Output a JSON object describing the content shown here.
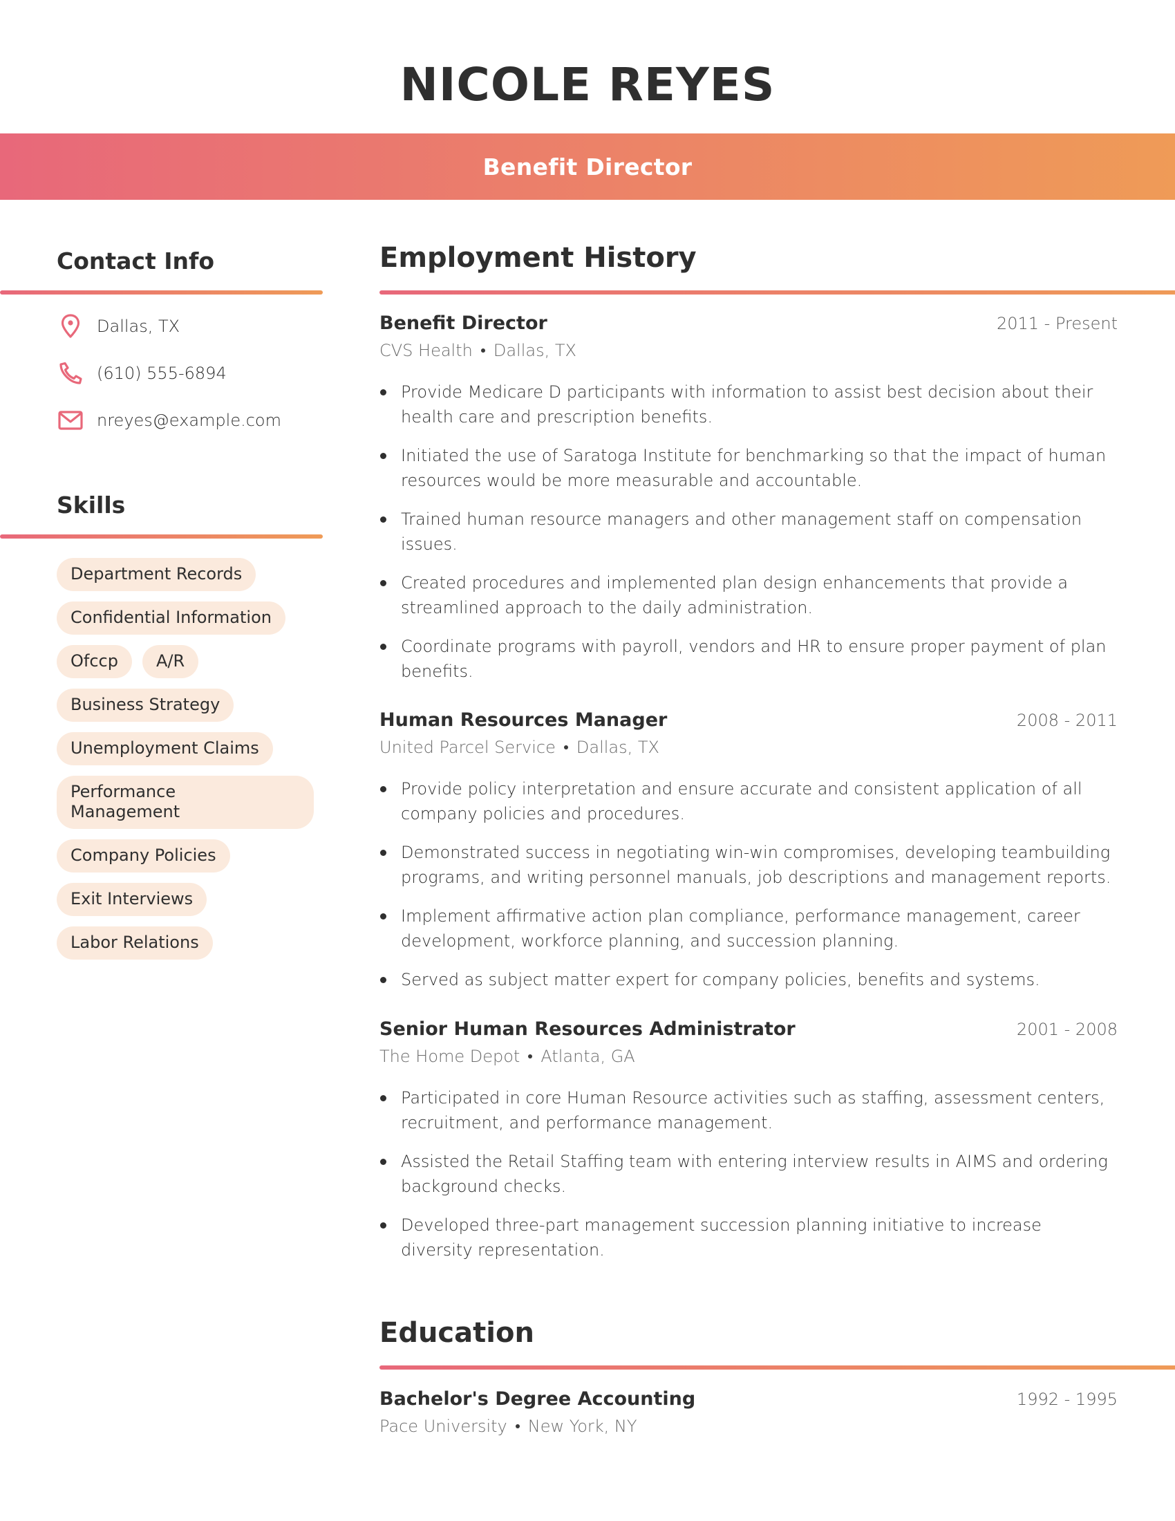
{
  "header": {
    "name": "NICOLE REYES",
    "title": "Benefit Director"
  },
  "colors": {
    "gradient_start": "#E8687A",
    "gradient_end": "#EF9B57",
    "pill_bg": "#FBEADD",
    "text": "#2f2f2f"
  },
  "contact": {
    "heading": "Contact Info",
    "items": [
      {
        "icon": "location-pin-icon",
        "text": "Dallas, TX"
      },
      {
        "icon": "phone-icon",
        "text": "(610) 555-6894"
      },
      {
        "icon": "mail-icon",
        "text": "nreyes@example.com"
      }
    ]
  },
  "skills": {
    "heading": "Skills",
    "items": [
      "Department Records",
      "Confidential Information",
      "Ofccp",
      "A/R",
      "Business Strategy",
      "Unemployment Claims",
      "Performance Management",
      "Company Policies",
      "Exit Interviews",
      "Labor Relations"
    ]
  },
  "employment": {
    "heading": "Employment History",
    "jobs": [
      {
        "title": "Benefit Director",
        "dates": "2011 - Present",
        "company": "CVS Health",
        "location": "Dallas, TX",
        "bullets": [
          "Provide Medicare D participants with information to assist best decision about their health care and prescription benefits.",
          "Initiated the use of Saratoga Institute for benchmarking so that the impact of human resources would be more measurable and accountable.",
          "Trained human resource managers and other management staff on compensation issues.",
          "Created procedures and implemented plan design enhancements that provide a streamlined approach to the daily administration.",
          "Coordinate programs with payroll, vendors and HR to ensure proper payment of plan benefits."
        ]
      },
      {
        "title": "Human Resources Manager",
        "dates": "2008 - 2011",
        "company": "United Parcel Service",
        "location": "Dallas, TX",
        "bullets": [
          "Provide policy interpretation and ensure accurate and consistent application of all company policies and procedures.",
          "Demonstrated success in negotiating win-win compromises, developing teambuilding programs, and writing personnel manuals, job descriptions and management reports.",
          "Implement affirmative action plan compliance, performance management, career development, workforce planning, and succession planning.",
          "Served as subject matter expert for company policies, benefits and systems."
        ]
      },
      {
        "title": "Senior Human Resources Administrator",
        "dates": "2001 - 2008",
        "company": "The Home Depot",
        "location": "Atlanta, GA",
        "bullets": [
          "Participated in core Human Resource activities such as staffing, assessment centers, recruitment, and performance management.",
          "Assisted the Retail Staffing team with entering interview results in AIMS and ordering background checks.",
          "Developed three-part management succession planning initiative to increase diversity representation."
        ]
      }
    ]
  },
  "education": {
    "heading": "Education",
    "items": [
      {
        "degree": "Bachelor's Degree Accounting",
        "dates": "1992 - 1995",
        "school": "Pace University",
        "location": "New York, NY"
      }
    ]
  }
}
